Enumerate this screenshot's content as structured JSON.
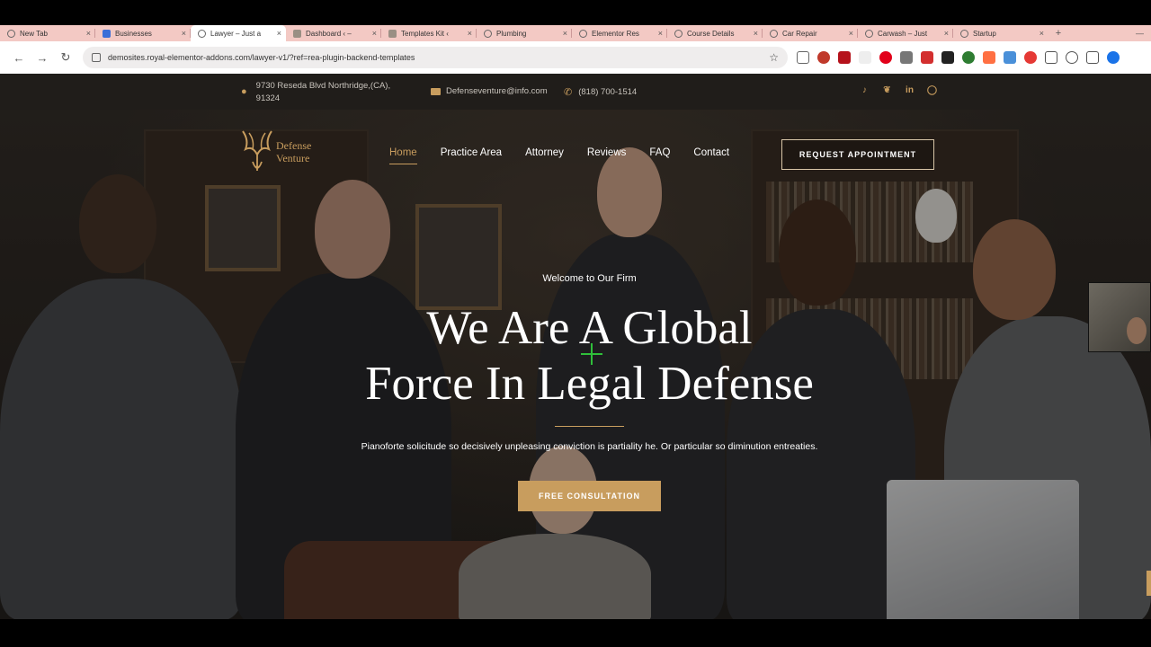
{
  "browser": {
    "tabs": [
      {
        "label": "New Tab",
        "active": false
      },
      {
        "label": "Businesses",
        "active": false
      },
      {
        "label": "Lawyer – Just a",
        "active": true
      },
      {
        "label": "Dashboard ‹ –",
        "active": false
      },
      {
        "label": "Templates Kit ‹",
        "active": false
      },
      {
        "label": "Plumbing",
        "active": false
      },
      {
        "label": "Elementor Res",
        "active": false
      },
      {
        "label": "Course Details",
        "active": false
      },
      {
        "label": "Car Repair",
        "active": false
      },
      {
        "label": "Carwash – Just",
        "active": false
      },
      {
        "label": "Startup",
        "active": false
      }
    ],
    "close_glyph": "×",
    "new_tab_glyph": "+",
    "url": "demosites.royal-elementor-addons.com/lawyer-v1/?ref=rea-plugin-backend-templates"
  },
  "infobar": {
    "address": "9730 Reseda Blvd Northridge,(CA), 91324",
    "email": "Defenseventure@info.com",
    "phone": "(818) 700-1514",
    "socials": [
      "tiktok-icon",
      "twitter-icon",
      "linkedin-icon",
      "instagram-icon"
    ]
  },
  "logo": {
    "line1": "Defense",
    "line2": "Venture"
  },
  "nav": {
    "items": [
      "Home",
      "Practice Area",
      "Attorney",
      "Reviews",
      "FAQ",
      "Contact"
    ],
    "active": "Home",
    "cta": "REQUEST APPOINTMENT"
  },
  "hero": {
    "welcome": "Welcome to Our Firm",
    "headline_line1": "We Are A Global",
    "headline_line2": "Force In Legal Defense",
    "subtext": "Pianoforte solicitude so decisively unpleasing conviction is partiality he. Or particular so diminution entreaties.",
    "cta": "FREE CONSULTATION"
  },
  "colors": {
    "accent_gold": "#c89d5e",
    "tabstrip": "#f3c9c4",
    "dark_bg": "#1c1a18"
  }
}
